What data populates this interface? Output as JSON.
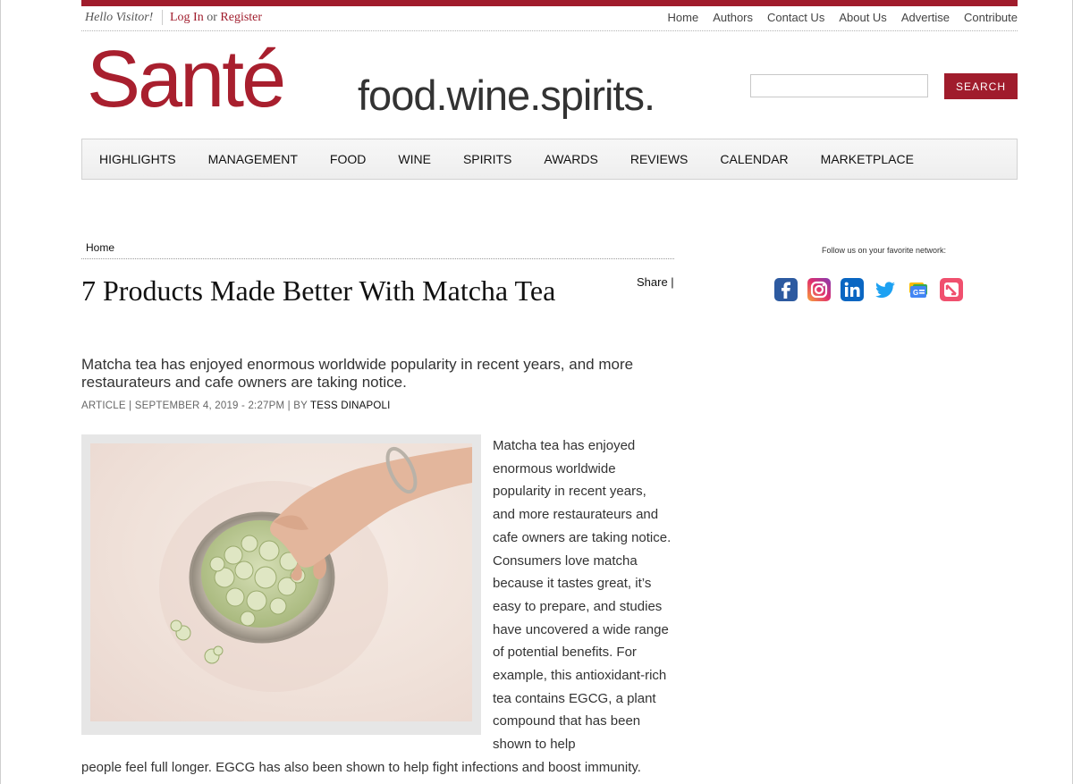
{
  "utility": {
    "greeting": "Hello Visitor!",
    "login": "Log In",
    "or": "or",
    "register": "Register",
    "links": [
      "Home",
      "Authors",
      "Contact Us",
      "About Us",
      "Advertise",
      "Contribute"
    ]
  },
  "logo": {
    "name": "Santé",
    "tagline": "food.wine.spirits."
  },
  "search": {
    "value": "",
    "button_label": "SEARCH"
  },
  "nav": {
    "items": [
      "HIGHLIGHTS",
      "MANAGEMENT",
      "FOOD",
      "WINE",
      "SPIRITS",
      "AWARDS",
      "REVIEWS",
      "CALENDAR",
      "MARKETPLACE"
    ]
  },
  "article": {
    "breadcrumb": "Home",
    "title": "7 Products Made Better With Matcha Tea",
    "share": "Share |",
    "subhead": "Matcha tea has enjoyed enormous worldwide popularity in recent years, and more restaurateurs and cafe owners are taking notice.",
    "byline_prefix": "ARTICLE | SEPTEMBER 4, 2019 - 2:27PM | BY",
    "author": "TESS DINAPOLI",
    "body_wrapped": "Matcha tea has enjoyed enormous worldwide popularity in recent years, and more restaurateurs and cafe owners are taking notice. Consumers love matcha because it tastes great, it’s easy to prepare, and studies have uncovered a wide range of potential benefits. For example, this antioxidant-rich tea contains EGCG, a plant compound that has been shown to help",
    "body_full": "people feel full longer. EGCG has also been shown to help fight infections and boost immunity."
  },
  "sidebar": {
    "follow_label": "Follow us on your favorite network:",
    "networks": [
      {
        "icon": "facebook-icon",
        "color": "#3b5998"
      },
      {
        "icon": "instagram-icon",
        "color": "#c13584"
      },
      {
        "icon": "linkedin-icon",
        "color": "#0a66c2"
      },
      {
        "icon": "twitter-icon",
        "color": "#1da1f2"
      },
      {
        "icon": "google-news-icon",
        "color": "#4285f4"
      },
      {
        "icon": "apple-news-icon",
        "color": "#f0506e"
      }
    ]
  },
  "colors": {
    "brand": "#a01c2c",
    "text": "#222222"
  }
}
